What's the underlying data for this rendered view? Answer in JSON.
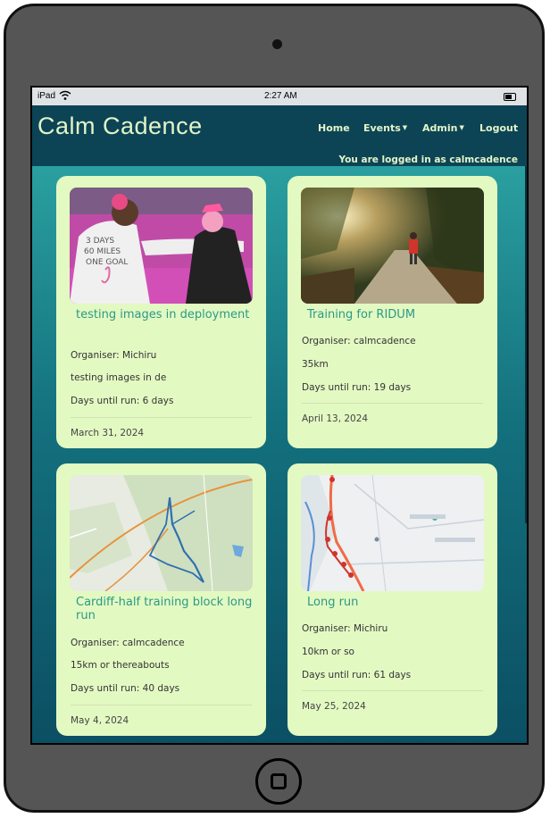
{
  "device": {
    "name": "iPad tablet frame"
  },
  "statusbar": {
    "carrier": "iPad",
    "time": "2:27 AM"
  },
  "navbar": {
    "brand": "Calm Cadence",
    "links": [
      {
        "label": "Home",
        "dropdown": false
      },
      {
        "label": "Events",
        "dropdown": true
      },
      {
        "label": "Admin",
        "dropdown": true
      },
      {
        "label": "Logout",
        "dropdown": false
      }
    ],
    "logged_in_text": "You are logged in as calmcadence"
  },
  "cards": [
    {
      "image": "runners-pink-shirt-photo",
      "title": "testing images in deployment",
      "organiser": "Organiser: Michiru",
      "description": "testing images in de",
      "days_until": "Days until run: 6 days",
      "date": "March 31, 2024"
    },
    {
      "image": "runner-on-path-photo",
      "title": "Training for RIDUM",
      "organiser": "Organiser: calmcadence",
      "description": "35km",
      "days_until": "Days until run: 19 days",
      "date": "April 13, 2024"
    },
    {
      "image": "route-map-blue",
      "title": "Cardiff-half training block long run",
      "organiser": "Organiser: calmcadence",
      "description": "15km or thereabouts",
      "days_until": "Days until run: 40 days",
      "date": "May 4, 2024"
    },
    {
      "image": "route-map-red",
      "title": "Long run",
      "organiser": "Organiser: Michiru",
      "description": "10km or so",
      "days_until": "Days until run: 61 days",
      "date": "May 25, 2024"
    }
  ],
  "colors": {
    "navbar": "#0c4456",
    "brand_text": "#e3f4c8",
    "card_bg": "#e3f9c2",
    "card_title": "#2a9a86",
    "content_gradient_top": "#2a9fa0",
    "content_gradient_bottom": "#0b4f63"
  }
}
